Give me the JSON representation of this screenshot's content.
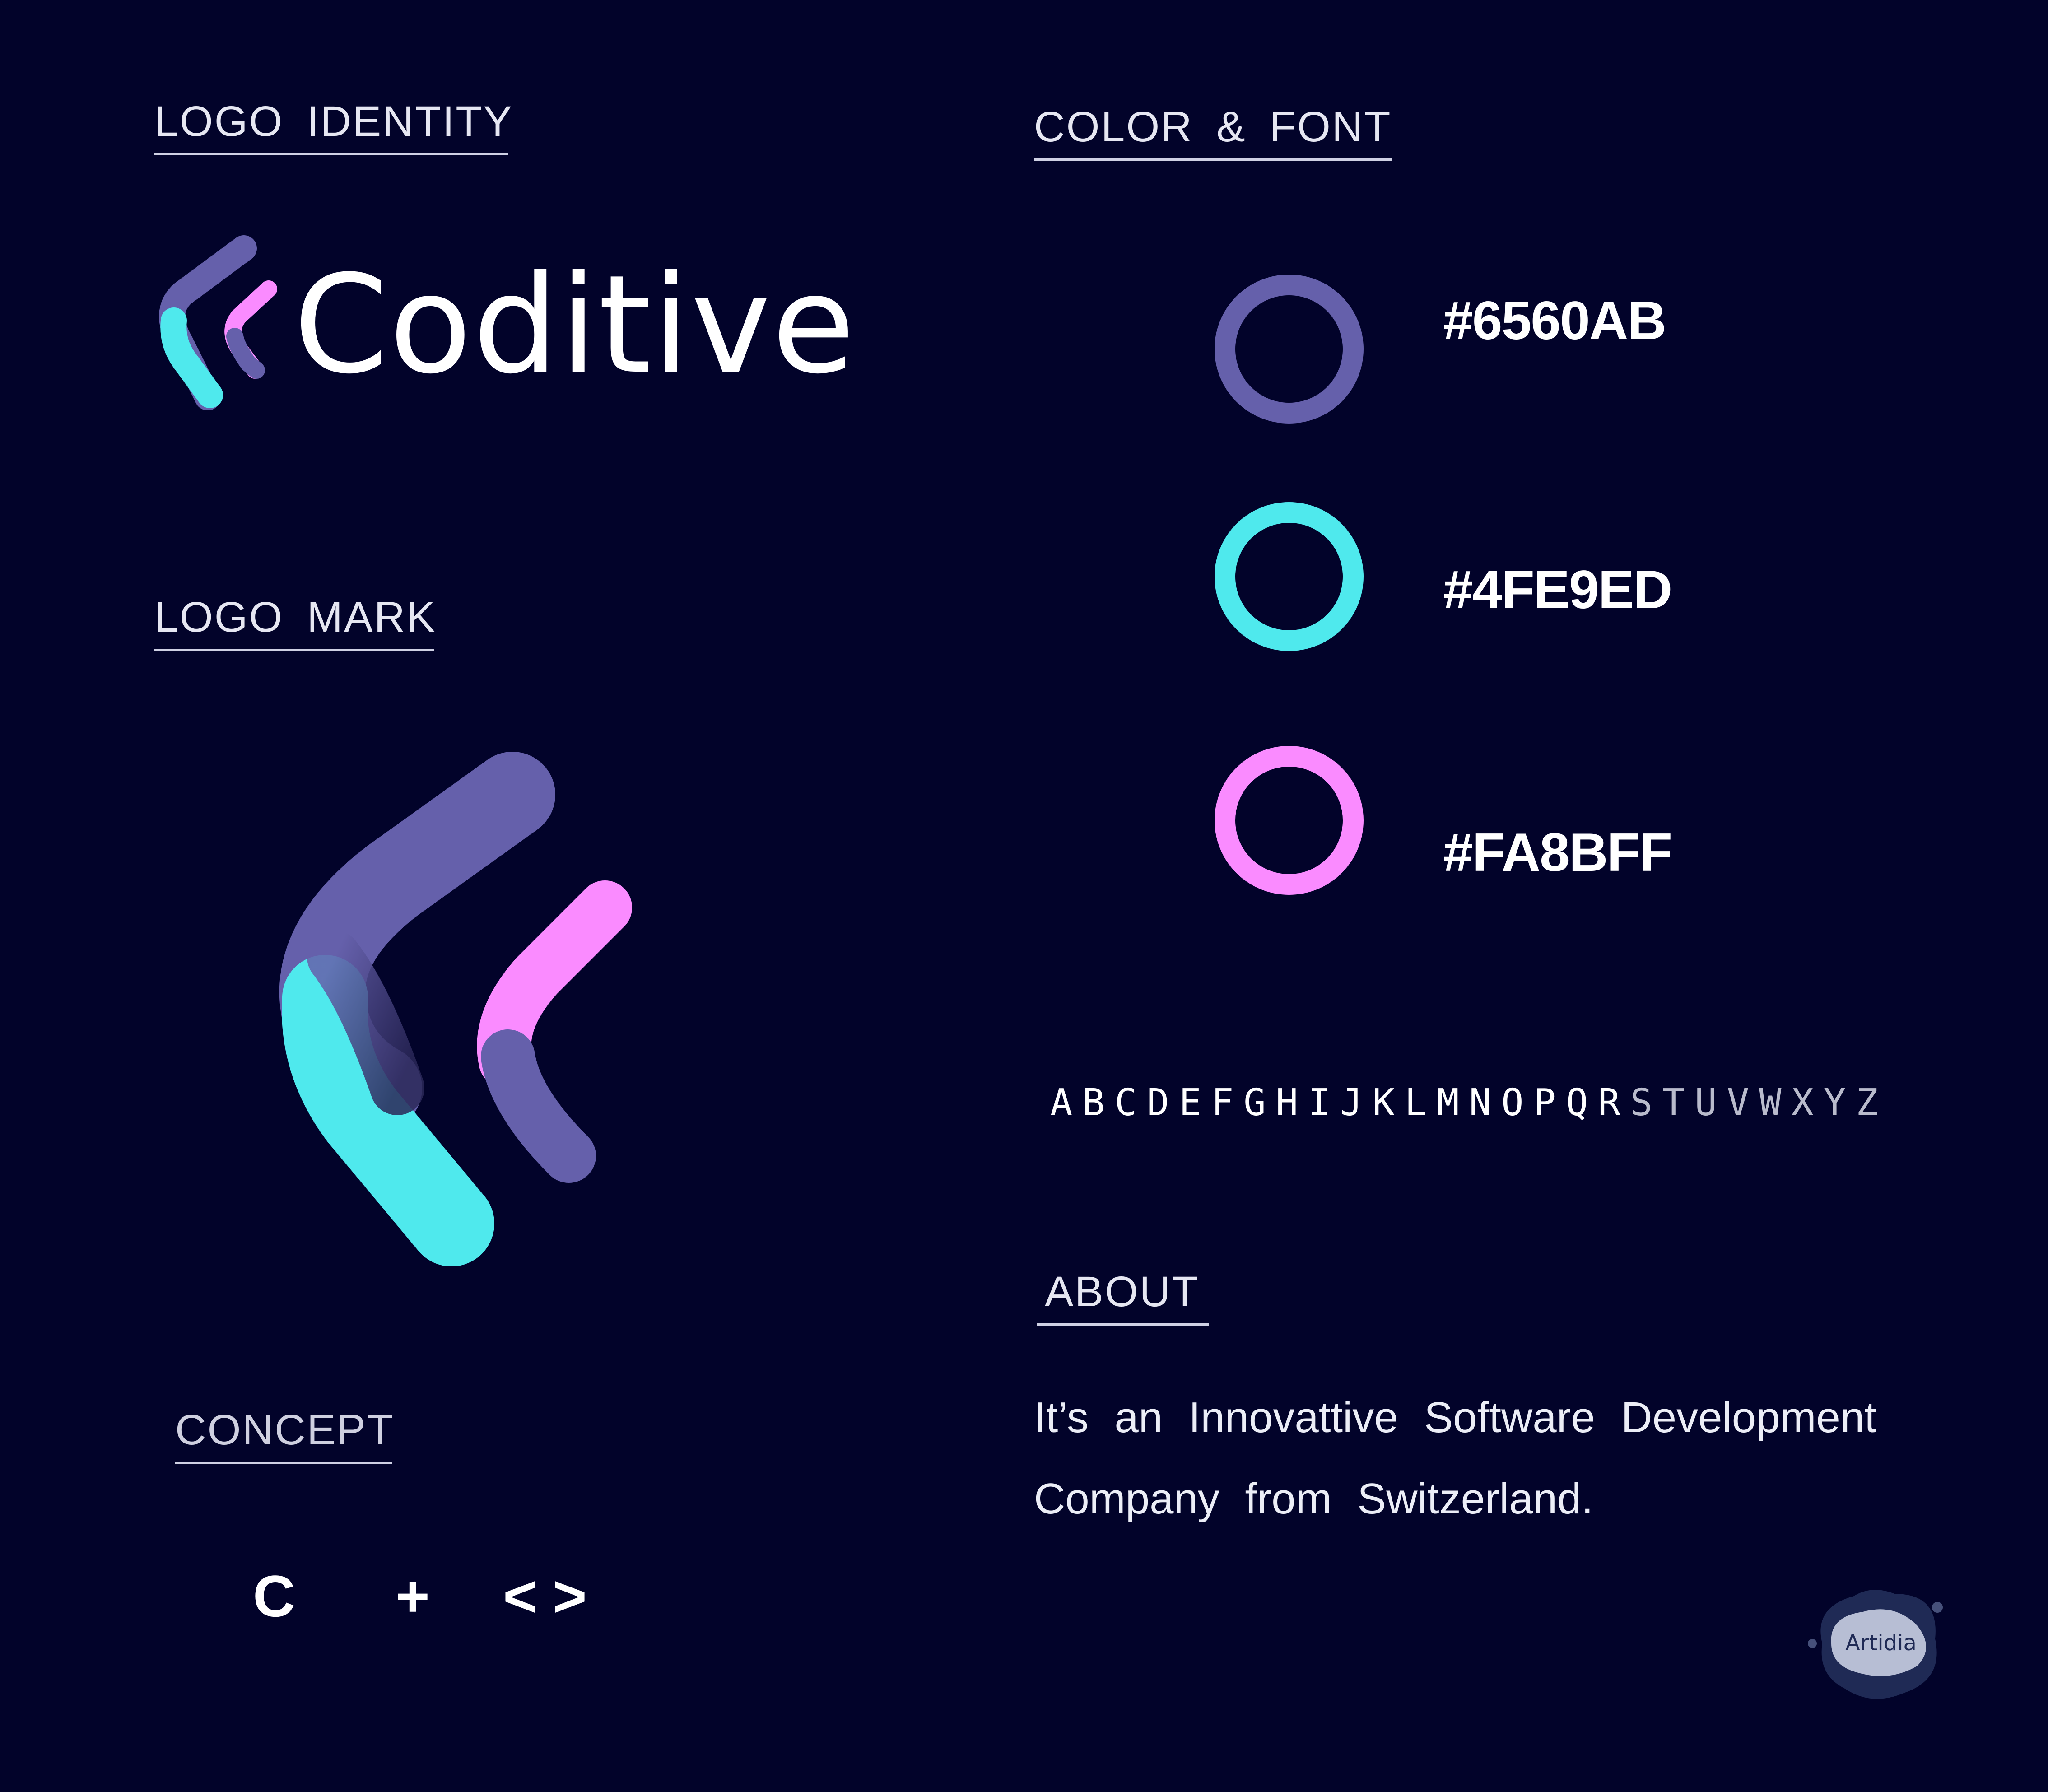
{
  "sections": {
    "logo_identity": "LOGO IDENTITY",
    "color_font": "COLOR & FONT",
    "logo_mark": "LOGO MARK",
    "concept": "CONCEPT",
    "about": "ABOUT"
  },
  "brand": {
    "name": "Coditive"
  },
  "palette": [
    {
      "hex": "#6560AB",
      "color": "#6560AB"
    },
    {
      "hex": "#4FE9ED",
      "color": "#4FE9ED"
    },
    {
      "hex": "#FA8BFF",
      "color": "#FA8BFF"
    }
  ],
  "alphabet": {
    "bright": "ABCDEFGHIJKLMNOPQR",
    "soft": "STUVWXYZ"
  },
  "about_text": "It’s an Innovattive Software Development Company from Switzerland.",
  "concept": {
    "c": "C",
    "plus": "+",
    "brackets": "<>"
  },
  "watermark": {
    "text": "Artidia"
  },
  "colors": {
    "background": "#02032A",
    "purple": "#6560AB",
    "cyan": "#4FE9ED",
    "pink": "#FA8BFF"
  }
}
